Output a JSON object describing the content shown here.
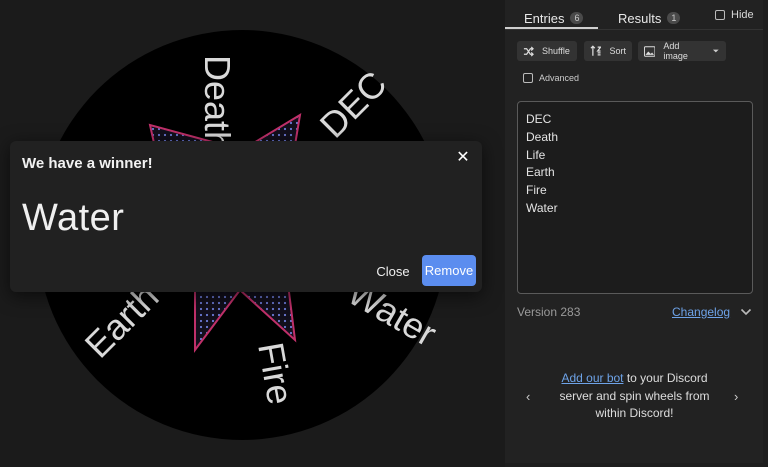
{
  "wheel": {
    "labels": [
      "Death",
      "DEC",
      "Water",
      "Fire",
      "Earth"
    ]
  },
  "modal": {
    "title": "We have a winner!",
    "close_icon": "close-icon",
    "winner": "Water",
    "close_label": "Close",
    "remove_label": "Remove",
    "accent": "#5b8def"
  },
  "tabs": {
    "entries_label": "Entries",
    "entries_count": "6",
    "results_label": "Results",
    "results_count": "1",
    "hide_label": "Hide"
  },
  "toolbar": {
    "shuffle_label": "Shuffle",
    "sort_label": "Sort",
    "add_image_label": "Add image",
    "advanced_label": "Advanced"
  },
  "entries": [
    "DEC",
    "Death",
    "Life",
    "Earth",
    "Fire",
    "Water"
  ],
  "footer": {
    "version": "Version 283",
    "changelog": "Changelog"
  },
  "promo": {
    "link_text": "Add our bot",
    "text": " to your Discord server and spin wheels from within Discord!",
    "link_color": "#6ea3e8"
  }
}
